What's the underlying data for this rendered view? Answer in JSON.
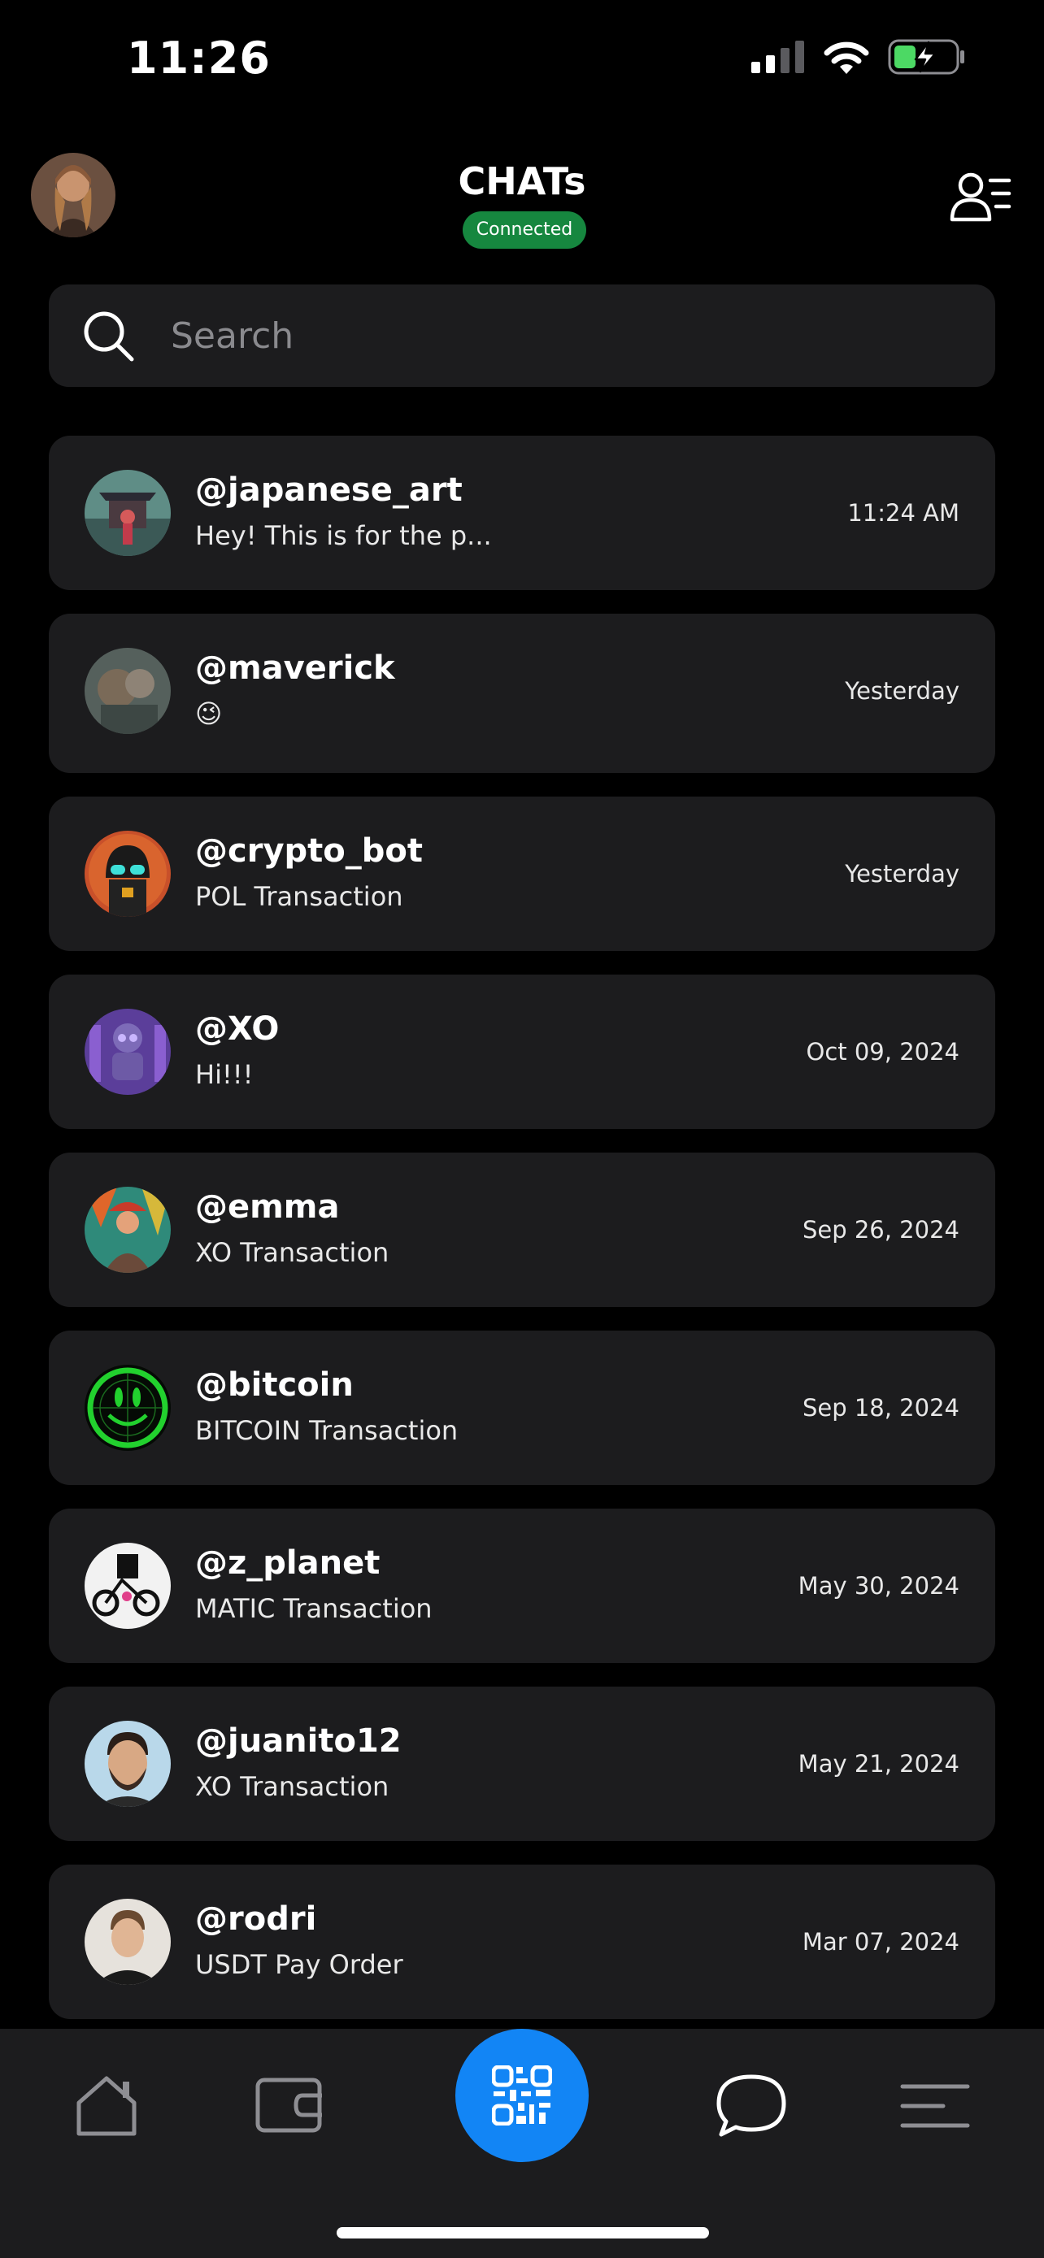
{
  "status_bar": {
    "time": "11:26"
  },
  "header": {
    "title": "CHATs",
    "connection_status": "Connected",
    "badge_color": "#16873f"
  },
  "search": {
    "placeholder": "Search",
    "value": ""
  },
  "chats": [
    {
      "name": "@japanese_art",
      "preview": "Hey! This is for the p...",
      "time": "11:24 AM"
    },
    {
      "name": "@maverick",
      "preview": "😉",
      "time": "Yesterday"
    },
    {
      "name": "@crypto_bot",
      "preview": "POL Transaction",
      "time": "Yesterday"
    },
    {
      "name": "@XO",
      "preview": "Hi!!!",
      "time": "Oct 09, 2024"
    },
    {
      "name": "@emma",
      "preview": "XO Transaction",
      "time": "Sep 26, 2024"
    },
    {
      "name": "@bitcoin",
      "preview": "BITCOIN Transaction",
      "time": "Sep 18, 2024"
    },
    {
      "name": "@z_planet",
      "preview": "MATIC Transaction",
      "time": "May 30, 2024"
    },
    {
      "name": "@juanito12",
      "preview": "XO Transaction",
      "time": "May 21, 2024"
    },
    {
      "name": "@rodri",
      "preview": "USDT Pay Order",
      "time": "Mar 07, 2024"
    }
  ],
  "tab_bar": {
    "items": [
      "home-icon",
      "wallet-icon",
      "qr-code-icon",
      "chat-bubble-icon",
      "menu-icon"
    ],
    "accent": "#1285f5"
  },
  "colors": {
    "background": "#000000",
    "card": "#1c1c1e",
    "battery_green": "#4cd964"
  }
}
